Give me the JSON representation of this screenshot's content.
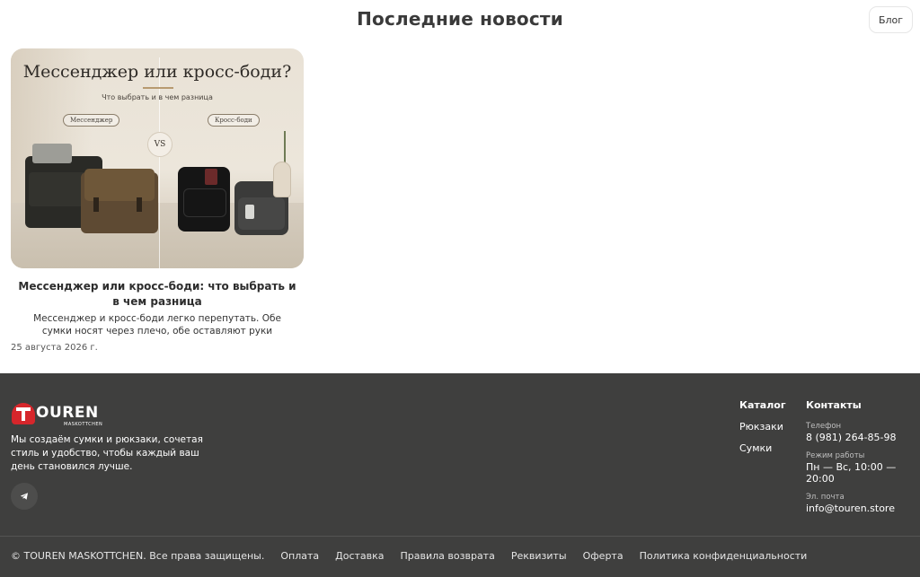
{
  "news": {
    "title": "Последние новости",
    "blog_button": "Блог",
    "card": {
      "image_heading": "Мессенджер или кросс-боди?",
      "image_subheading": "Что выбрать и в чем разница",
      "image_label_left": "Мессенджер",
      "image_label_right": "Кросс-боди",
      "image_vs": "VS",
      "title": "Мессенджер или кросс-боди: что выбрать и в чем разница",
      "excerpt": "Мессенджер и кросс-боди легко перепутать. Обе сумки носят через плечо, обе оставляют руки свободными, обе...",
      "date": "25 августа 2026 г."
    }
  },
  "footer": {
    "logo_text": "OUREN",
    "logo_sub": "MASKOTTCHEN",
    "about": "Мы создаём сумки и рюкзаки, сочетая стиль и удобство, чтобы каждый ваш день становился лучше.",
    "social_icon": "telegram-icon",
    "catalog": {
      "heading": "Каталог",
      "links": [
        "Рюкзаки",
        "Сумки"
      ]
    },
    "contacts": {
      "heading": "Контакты",
      "phone_label": "Телефон",
      "phone": "8 (981) 264-85-98",
      "hours_label": "Режим работы",
      "hours": "Пн — Вс, 10:00 — 20:00",
      "email_label": "Эл. почта",
      "email": "info@touren.store"
    },
    "copyright": "© TOUREN MASKOTTCHEN. Все права защищены.",
    "links": [
      "Оплата",
      "Доставка",
      "Правила возврата",
      "Реквизиты",
      "Оферта",
      "Политика конфиденциальности"
    ]
  },
  "colors": {
    "footer_bg": "#3f3f3e",
    "logo_red": "#d6262b",
    "text_dark": "#222222"
  }
}
